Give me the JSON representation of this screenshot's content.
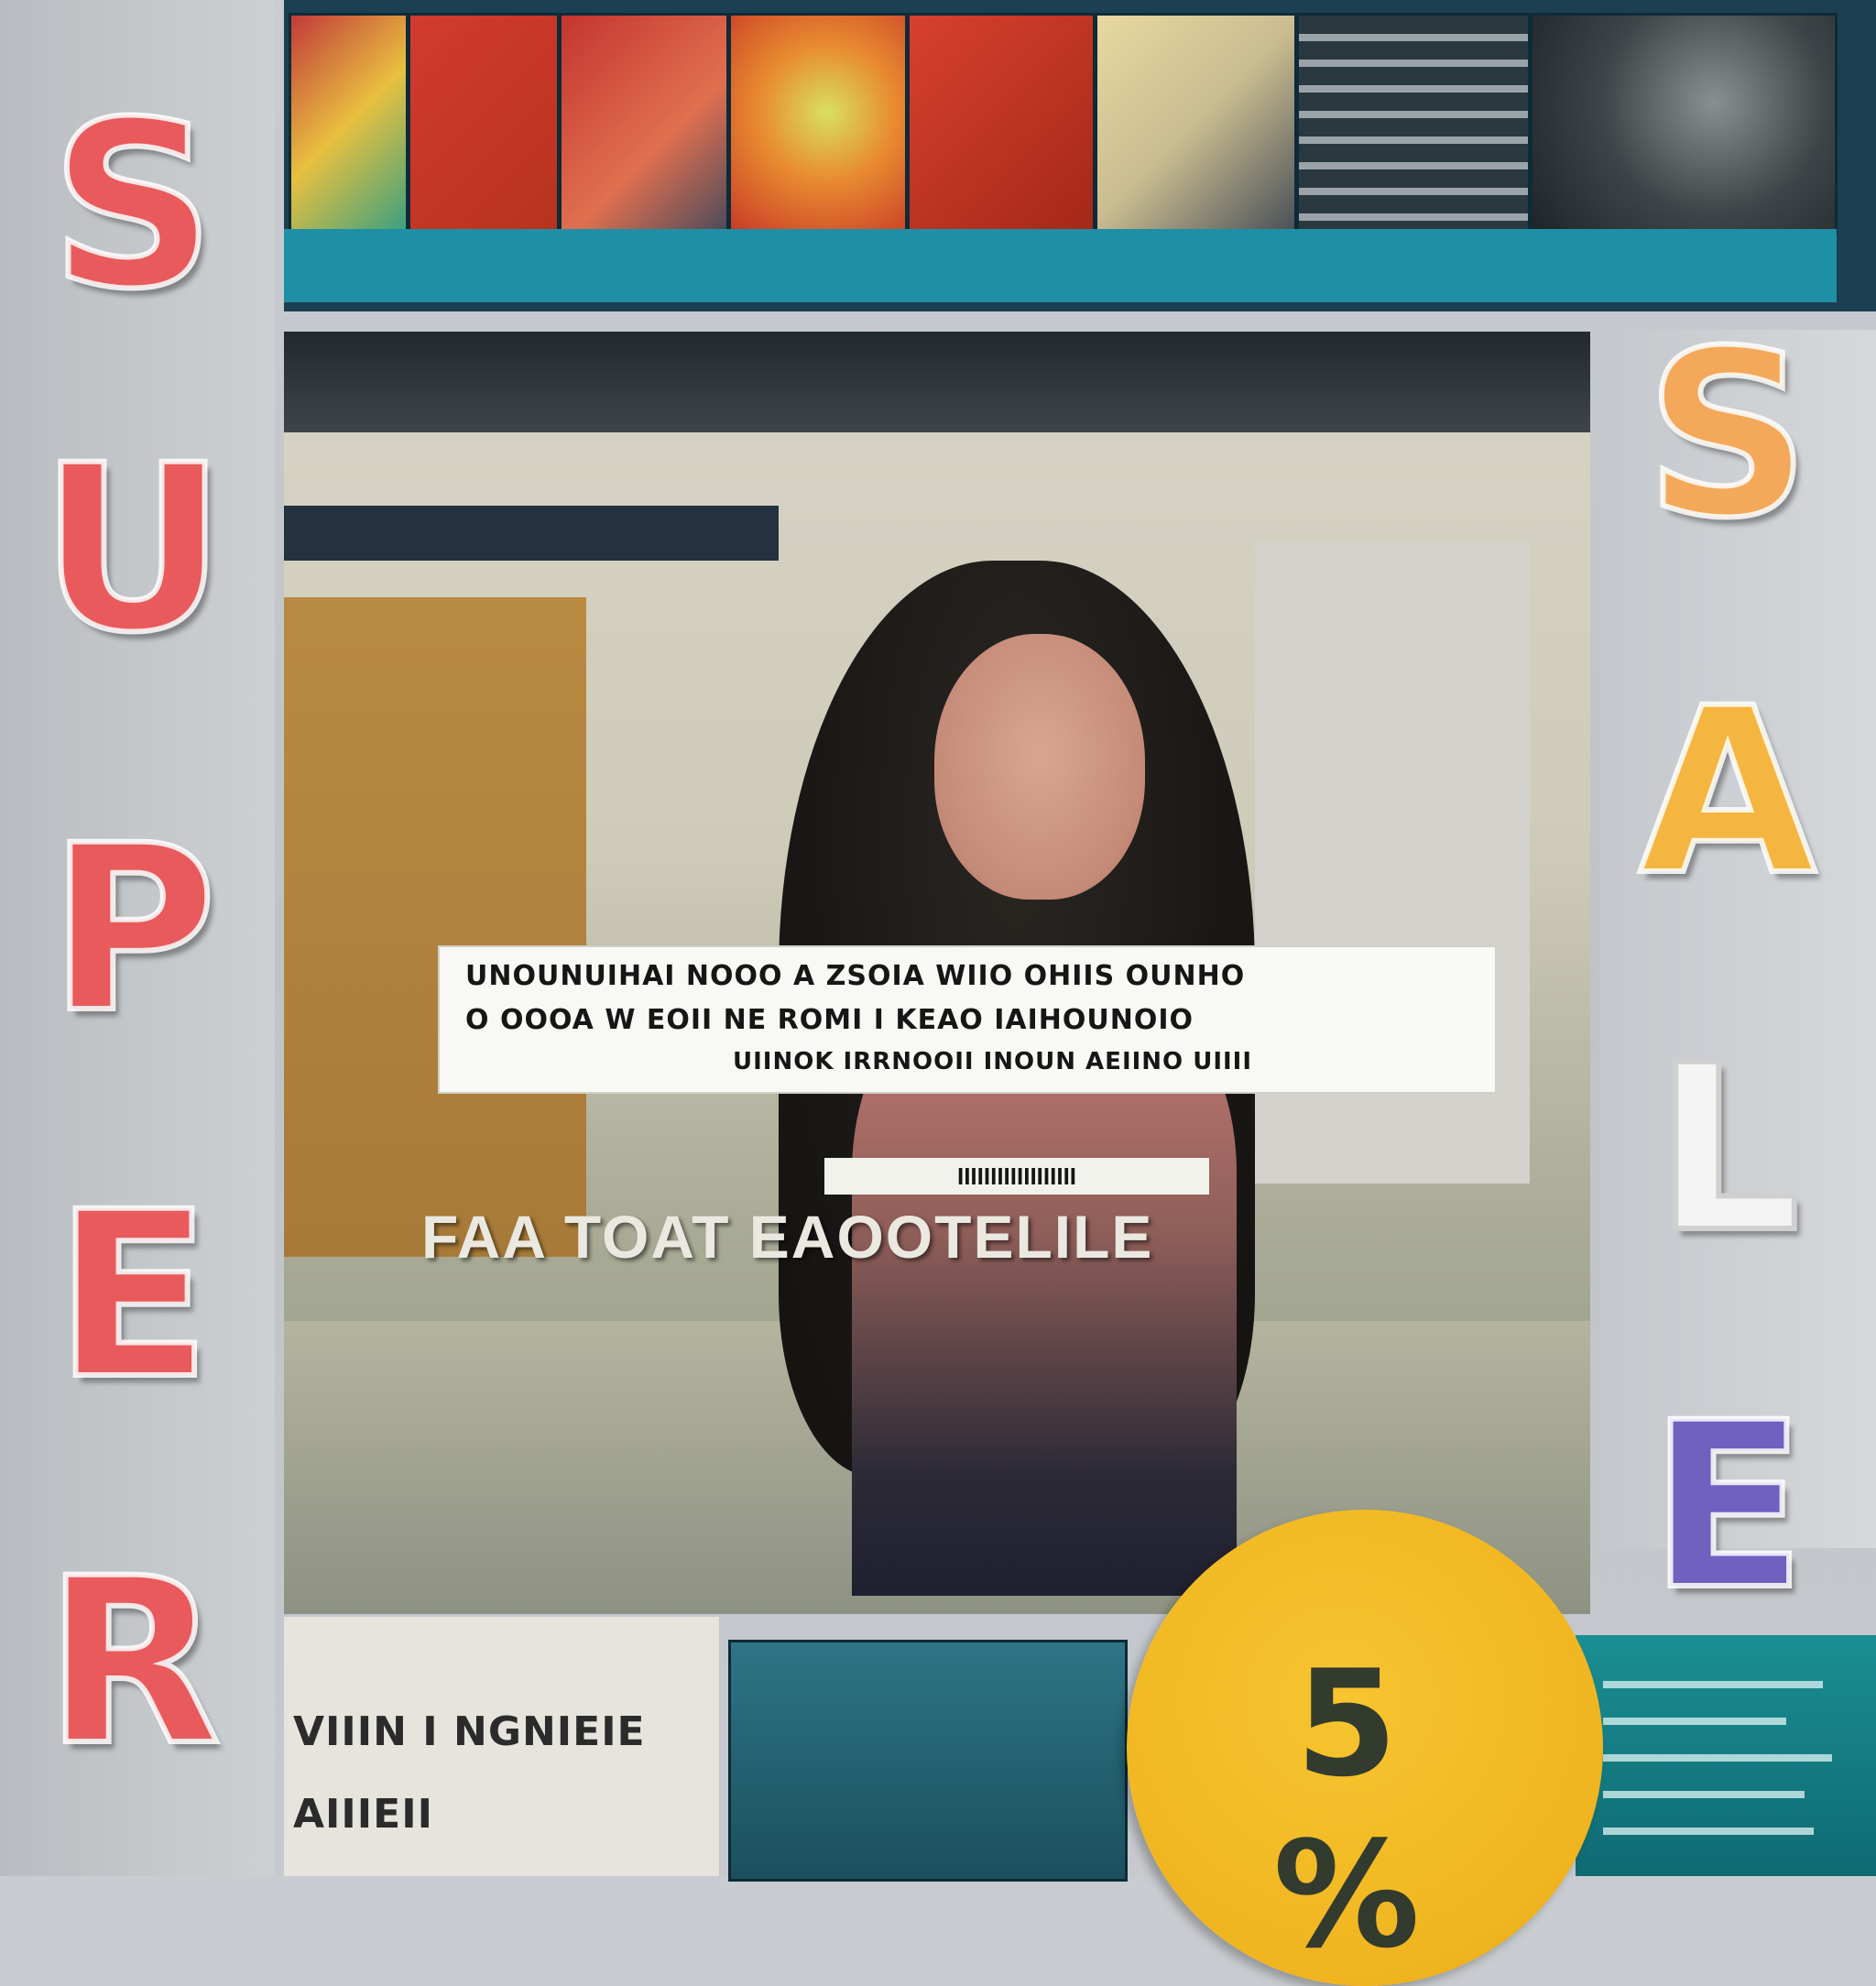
{
  "left_word": {
    "letters": [
      "S",
      "U",
      "P",
      "E",
      "R"
    ],
    "color": "#e85a5c"
  },
  "right_word": {
    "letters": [
      {
        "char": "S",
        "color": "#f4a85a"
      },
      {
        "char": "A",
        "color": "#f4b640"
      },
      {
        "char": "L",
        "color": "#f4f4f4"
      },
      {
        "char": "E",
        "color": "#7060c0"
      }
    ]
  },
  "hero": {
    "caption_lines": [
      "UNOUNUIHAI NOOO A ZSOIA WIIO OHIIS OUNHO",
      "O OOOA W EOII NE ROMI I KEAO IAIHOUNOIO",
      "UIINOK IRRNOOII INOUN AEIINO UIIII"
    ],
    "sub_label": "IIIIIIIIIIIIIIIIII",
    "overlay_title": "FAA TOAT EAOOTELILE"
  },
  "bottom_left_lines": [
    "VIIIN I NGNIEIE",
    "AIIIEII"
  ],
  "badge": {
    "text": "5 %",
    "color": "#f0b520"
  }
}
